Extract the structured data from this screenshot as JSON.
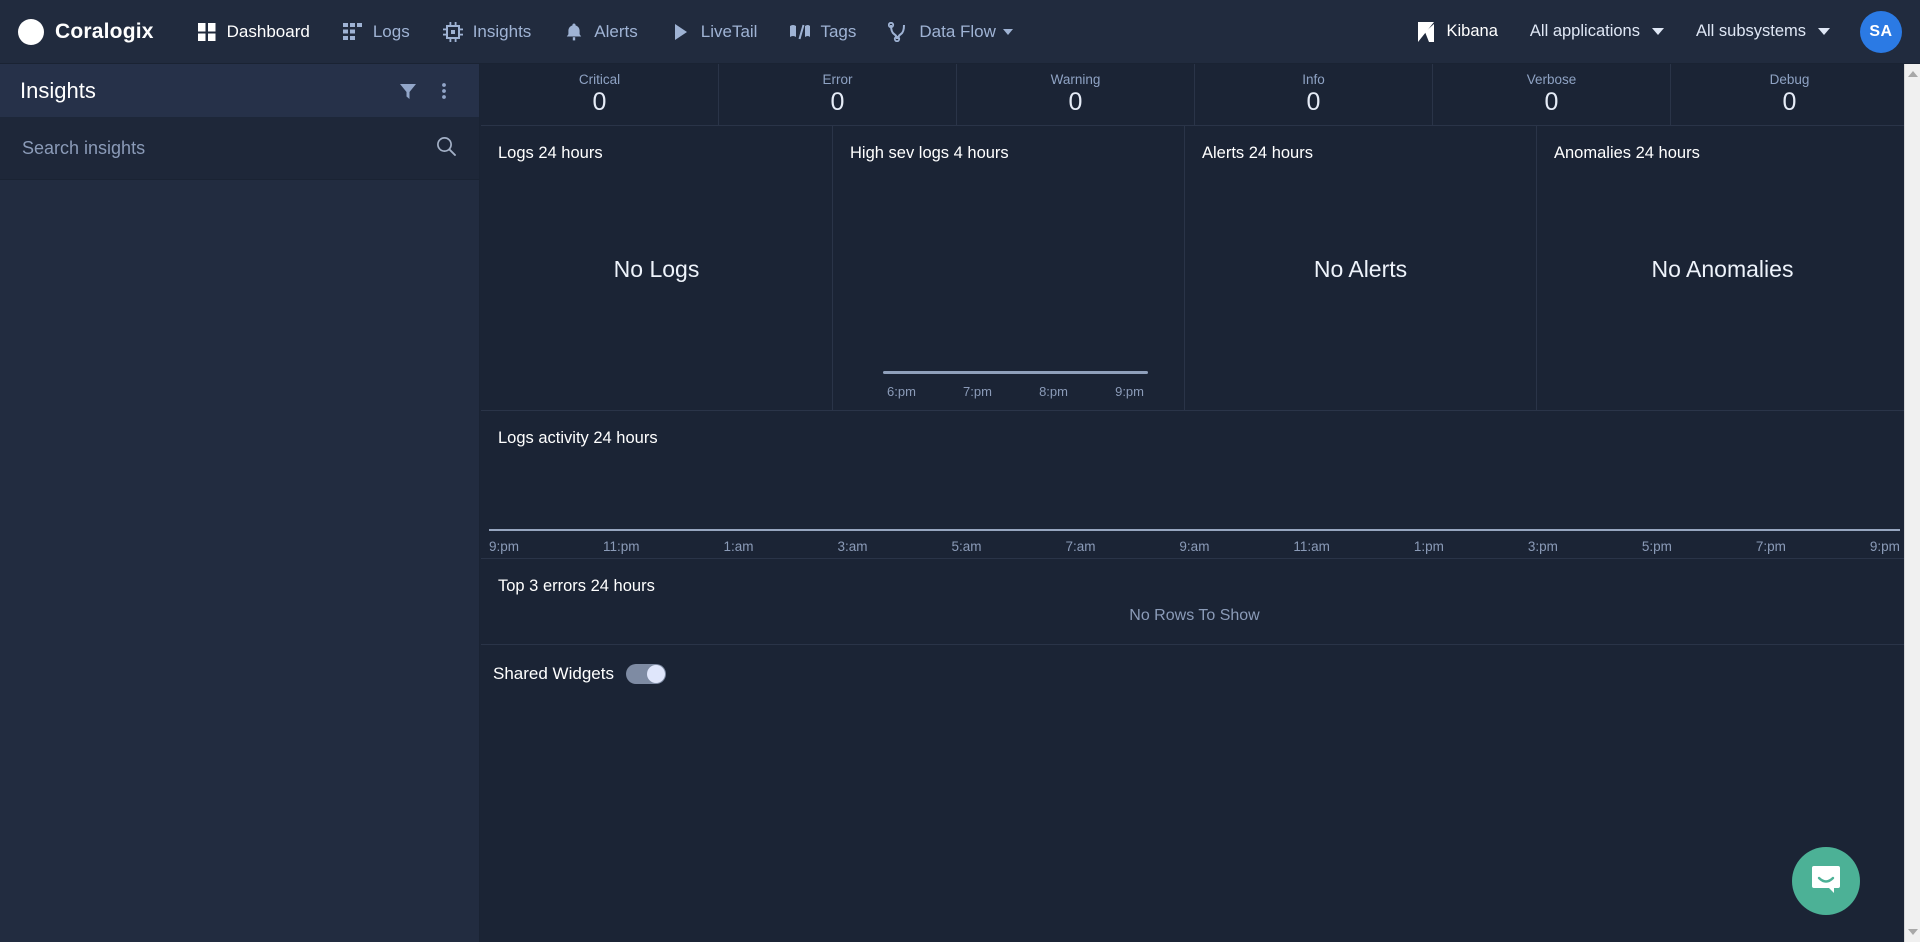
{
  "navbar": {
    "brand": "Coralogix",
    "items": [
      {
        "label": "Dashboard",
        "icon": "grid-icon",
        "active": true
      },
      {
        "label": "Logs",
        "icon": "logs-icon",
        "active": false
      },
      {
        "label": "Insights",
        "icon": "chip-icon",
        "active": false
      },
      {
        "label": "Alerts",
        "icon": "bell-icon",
        "active": false
      },
      {
        "label": "LiveTail",
        "icon": "play-icon",
        "active": false
      },
      {
        "label": "Tags",
        "icon": "tags-icon",
        "active": false
      },
      {
        "label": "Data Flow",
        "icon": "dataflow-icon",
        "active": false,
        "caret": true
      }
    ],
    "kibana": "Kibana",
    "applications_filter": "All applications",
    "subsystems_filter": "All subsystems",
    "avatar_initials": "SA"
  },
  "sidebar": {
    "title": "Insights",
    "filter_icon": "filter-icon",
    "more_icon": "more-vertical-icon",
    "search": {
      "placeholder": "Search insights",
      "value": "",
      "icon": "search-icon"
    }
  },
  "severity": {
    "cells": [
      {
        "label": "Critical",
        "value": "0"
      },
      {
        "label": "Error",
        "value": "0"
      },
      {
        "label": "Warning",
        "value": "0"
      },
      {
        "label": "Info",
        "value": "0"
      },
      {
        "label": "Verbose",
        "value": "0"
      },
      {
        "label": "Debug",
        "value": "0"
      }
    ]
  },
  "widgets": {
    "logs": {
      "title": "Logs 24 hours",
      "empty": "No Logs"
    },
    "high_sev": {
      "title": "High sev logs 4 hours",
      "empty": ""
    },
    "alerts": {
      "title": "Alerts 24 hours",
      "empty": "No Alerts"
    },
    "anomalies": {
      "title": "Anomalies 24 hours",
      "empty": "No Anomalies"
    }
  },
  "activity": {
    "title": "Logs activity 24 hours"
  },
  "top_errors": {
    "title": "Top 3 errors 24 hours",
    "empty": "No Rows To Show"
  },
  "shared_widgets": {
    "label": "Shared Widgets",
    "enabled": true
  },
  "intercom": {
    "icon": "chat-bubble-icon"
  },
  "colors": {
    "navbar_bg": "#212b3e",
    "sidebar_bg": "#222c40",
    "main_bg": "#1b2435",
    "accent_blue": "#2b7ae4",
    "nav_text": "#9fb3d4",
    "intercom_green": "#4cb196",
    "divider": "#2a3448"
  },
  "chart_data": [
    {
      "type": "bar",
      "title": "High sev logs 4 hours",
      "categories": [
        "6:pm",
        "7:pm",
        "8:pm",
        "9:pm"
      ],
      "values": [
        0,
        0,
        0,
        0
      ],
      "xlabel": "",
      "ylabel": "",
      "ylim": [
        0,
        0
      ],
      "grid": false,
      "legend": "none",
      "annotations": []
    },
    {
      "type": "bar",
      "title": "Logs activity 24 hours",
      "categories": [
        "9:pm",
        "11:pm",
        "1:am",
        "3:am",
        "5:am",
        "7:am",
        "9:am",
        "11:am",
        "1:pm",
        "3:pm",
        "5:pm",
        "7:pm",
        "9:pm"
      ],
      "values": [
        0,
        0,
        0,
        0,
        0,
        0,
        0,
        0,
        0,
        0,
        0,
        0,
        0
      ],
      "xlabel": "",
      "ylabel": "",
      "ylim": [
        0,
        0
      ],
      "grid": false,
      "legend": "none",
      "annotations": []
    },
    {
      "type": "table",
      "title": "Top 3 errors 24 hours",
      "categories": [],
      "values": [],
      "annotations": [
        "No Rows To Show"
      ]
    }
  ]
}
